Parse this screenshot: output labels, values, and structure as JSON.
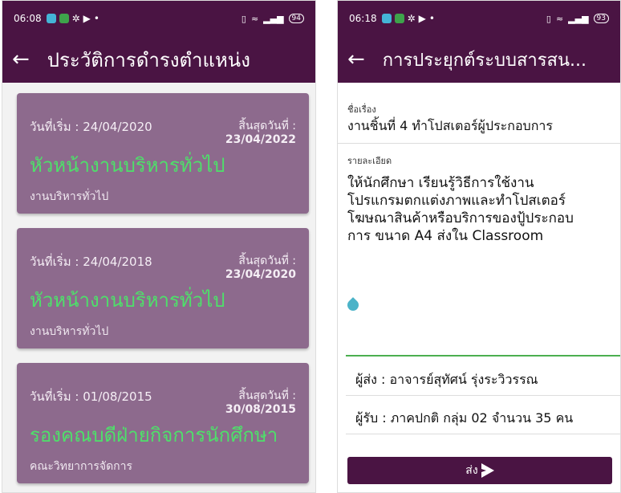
{
  "left": {
    "status": {
      "time": "06:08",
      "battery": "94"
    },
    "title": "ประวัติการดำรงตำแหน่ง",
    "cards": [
      {
        "start": "วันที่เริ่ม : 24/04/2020",
        "end_label": "สิ้นสุดวันที่ :",
        "end_date": "23/04/2022",
        "position": "หัวหน้างานบริหารทั่วไป",
        "dept": "งานบริหารทั่วไป"
      },
      {
        "start": "วันที่เริ่ม : 24/04/2018",
        "end_label": "สิ้นสุดวันที่ :",
        "end_date": "23/04/2020",
        "position": "หัวหน้างานบริหารทั่วไป",
        "dept": "งานบริหารทั่วไป"
      },
      {
        "start": "วันที่เริ่ม : 01/08/2015",
        "end_label": "สิ้นสุดวันที่ :",
        "end_date": "30/08/2015",
        "position": "รองคณบดีฝ่ายกิจการนักศึกษา",
        "dept": "คณะวิทยาการจัดการ"
      }
    ]
  },
  "right": {
    "status": {
      "time": "06:18",
      "battery": "93"
    },
    "title": "การประยุกต์ระบบสารสน...",
    "subject_label": "ชื่อเรื่อง",
    "subject": "งานชิ้นที่ 4 ทำโปสเตอร์ผู้ประกอบการ",
    "detail_label": "รายละเอียด",
    "detail_lines": [
      "ให้นักศึกษา เรียนรู้วิธีการใช้งาน",
      "โปรแกรมตกแต่งภาพและทำโปสเตอร์",
      "โฆษณาสินค้าหรือบริการของปู้ประกอบ",
      "การ ขนาด A4 ส่งใน Classroom"
    ],
    "sender": "ผู้ส่ง : อาจารย์สุทัศน์ รุ่งระวิวรรณ",
    "receiver": "ผู้รับ : ภาคปกติ กลุ่ม 02 จำนวน 35 คน",
    "send_label": "ส่ง"
  },
  "colors": {
    "primary": "#4a1443",
    "card": "#8d6a8d",
    "position_green": "#4ee06a"
  }
}
